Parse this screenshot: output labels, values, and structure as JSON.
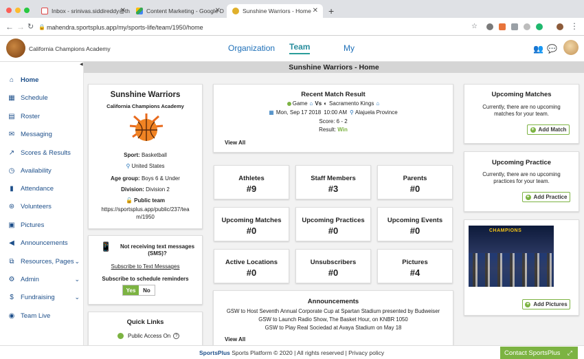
{
  "browser": {
    "tabs": [
      {
        "label": "Inbox - srinivas.siddireddy@th"
      },
      {
        "label": "Content Marketing - Google D"
      },
      {
        "label": "Sunshine Warriors - Home"
      }
    ],
    "url": "mahendra.sportsplus.app/my/sports-life/team/1950/home"
  },
  "header": {
    "brand": "California Champions Academy",
    "nav": [
      "Organization",
      "Team",
      "My"
    ]
  },
  "sidebar": {
    "items": [
      {
        "label": "Home",
        "icon": "home-icon"
      },
      {
        "label": "Schedule",
        "icon": "calendar-icon"
      },
      {
        "label": "Roster",
        "icon": "roster-icon"
      },
      {
        "label": "Messaging",
        "icon": "envelope-icon"
      },
      {
        "label": "Scores & Results",
        "icon": "chart-icon"
      },
      {
        "label": "Availability",
        "icon": "clock-icon"
      },
      {
        "label": "Attendance",
        "icon": "list-icon"
      },
      {
        "label": "Volunteers",
        "icon": "volunteer-icon"
      },
      {
        "label": "Pictures",
        "icon": "picture-icon"
      },
      {
        "label": "Announcements",
        "icon": "megaphone-icon"
      },
      {
        "label": "Resources, Pages",
        "icon": "resources-icon"
      },
      {
        "label": "Admin",
        "icon": "gear-icon"
      },
      {
        "label": "Fundraising",
        "icon": "dollar-icon"
      },
      {
        "label": "Team Live",
        "icon": "live-icon"
      }
    ]
  },
  "page": {
    "title": "Sunshine Warriors - Home"
  },
  "team": {
    "name": "Sunshine Warriors",
    "org": "California Champions Academy",
    "sport_label": "Sport:",
    "sport": "Basketball",
    "country": "United States",
    "age_label": "Age group:",
    "age_group": "Boys 6 & Under",
    "division_label": "Division:",
    "division": "Division 2",
    "public": "Public team",
    "public_url_1": "https://sportsplus.app/public/237/tea",
    "public_url_2": "m/1950"
  },
  "sms": {
    "line1": "Not receiving text messages",
    "line2": "(SMS)?",
    "link": "Subscribe to Text Messages",
    "reminders": "Subscribe to schedule reminders",
    "yes": "Yes",
    "no": "No"
  },
  "quick_links": {
    "title": "Quick Links",
    "public_access": "Public Access On"
  },
  "match": {
    "title": "Recent Match Result",
    "game": "Game",
    "vs": "Vs",
    "opponent": "Sacramento Kings",
    "date": "Mon, Sep 17 2018",
    "time": "10:00 AM",
    "location": "Alajuela Province",
    "score": "Score: 6 - 2",
    "result_label": "Result:",
    "result": "Win",
    "view_all": "View All"
  },
  "stats": [
    {
      "label": "Athletes",
      "value": "#9"
    },
    {
      "label": "Staff Members",
      "value": "#3"
    },
    {
      "label": "Parents",
      "value": "#0"
    },
    {
      "label": "Upcoming Matches",
      "value": "#0"
    },
    {
      "label": "Upcoming Practices",
      "value": "#0"
    },
    {
      "label": "Upcoming Events",
      "value": "#0"
    },
    {
      "label": "Active Locations",
      "value": "#0"
    },
    {
      "label": "Unsubscribers",
      "value": "#0"
    },
    {
      "label": "Pictures",
      "value": "#4"
    }
  ],
  "announcements": {
    "title": "Announcements",
    "items": [
      "GSW to Host Seventh Annual Corporate Cup at Spartan Stadium presented by Budweiser",
      "GSW to Launch Radio Show, The Basket Hour, on KNBR 1050",
      "GSW to Play Real Sociedad at Avaya Stadium on May 18"
    ],
    "view_all": "View All"
  },
  "upcoming_matches": {
    "title": "Upcoming Matches",
    "text1": "Currently, there are no upcoming",
    "text2": "matches for your team.",
    "button": "Add Match"
  },
  "upcoming_practice": {
    "title": "Upcoming Practice",
    "text1": "Currently, there are no upcoming",
    "text2": "practices for your team.",
    "button": "Add Practice"
  },
  "pictures": {
    "photo_caption": "CHAMPIONS",
    "button": "Add Pictures"
  },
  "footer": {
    "brand": "SportsPlus",
    "text": "Sports Platform © 2020 | All rights reserved | Privacy policy",
    "contact": "Contact SportsPlus"
  },
  "colors": {
    "accent_green": "#7cb342",
    "nav_blue": "#1d6fb8"
  }
}
